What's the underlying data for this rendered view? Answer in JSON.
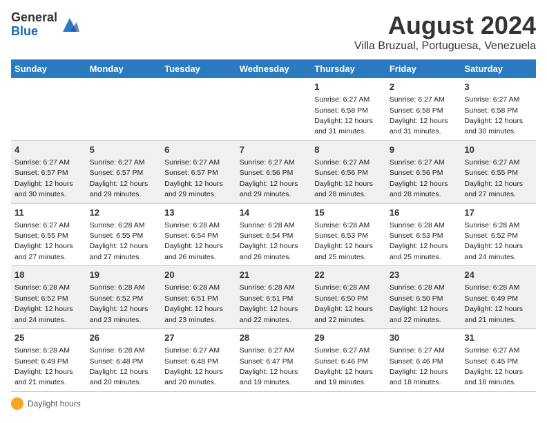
{
  "logo": {
    "general": "General",
    "blue": "Blue"
  },
  "title": "August 2024",
  "subtitle": "Villa Bruzual, Portuguesa, Venezuela",
  "days_of_week": [
    "Sunday",
    "Monday",
    "Tuesday",
    "Wednesday",
    "Thursday",
    "Friday",
    "Saturday"
  ],
  "weeks": [
    [
      {
        "num": "",
        "info": ""
      },
      {
        "num": "",
        "info": ""
      },
      {
        "num": "",
        "info": ""
      },
      {
        "num": "",
        "info": ""
      },
      {
        "num": "1",
        "info": "Sunrise: 6:27 AM\nSunset: 6:58 PM\nDaylight: 12 hours and 31 minutes."
      },
      {
        "num": "2",
        "info": "Sunrise: 6:27 AM\nSunset: 6:58 PM\nDaylight: 12 hours and 31 minutes."
      },
      {
        "num": "3",
        "info": "Sunrise: 6:27 AM\nSunset: 6:58 PM\nDaylight: 12 hours and 30 minutes."
      }
    ],
    [
      {
        "num": "4",
        "info": "Sunrise: 6:27 AM\nSunset: 6:57 PM\nDaylight: 12 hours and 30 minutes."
      },
      {
        "num": "5",
        "info": "Sunrise: 6:27 AM\nSunset: 6:57 PM\nDaylight: 12 hours and 29 minutes."
      },
      {
        "num": "6",
        "info": "Sunrise: 6:27 AM\nSunset: 6:57 PM\nDaylight: 12 hours and 29 minutes."
      },
      {
        "num": "7",
        "info": "Sunrise: 6:27 AM\nSunset: 6:56 PM\nDaylight: 12 hours and 29 minutes."
      },
      {
        "num": "8",
        "info": "Sunrise: 6:27 AM\nSunset: 6:56 PM\nDaylight: 12 hours and 28 minutes."
      },
      {
        "num": "9",
        "info": "Sunrise: 6:27 AM\nSunset: 6:56 PM\nDaylight: 12 hours and 28 minutes."
      },
      {
        "num": "10",
        "info": "Sunrise: 6:27 AM\nSunset: 6:55 PM\nDaylight: 12 hours and 27 minutes."
      }
    ],
    [
      {
        "num": "11",
        "info": "Sunrise: 6:27 AM\nSunset: 6:55 PM\nDaylight: 12 hours and 27 minutes."
      },
      {
        "num": "12",
        "info": "Sunrise: 6:28 AM\nSunset: 6:55 PM\nDaylight: 12 hours and 27 minutes."
      },
      {
        "num": "13",
        "info": "Sunrise: 6:28 AM\nSunset: 6:54 PM\nDaylight: 12 hours and 26 minutes."
      },
      {
        "num": "14",
        "info": "Sunrise: 6:28 AM\nSunset: 6:54 PM\nDaylight: 12 hours and 26 minutes."
      },
      {
        "num": "15",
        "info": "Sunrise: 6:28 AM\nSunset: 6:53 PM\nDaylight: 12 hours and 25 minutes."
      },
      {
        "num": "16",
        "info": "Sunrise: 6:28 AM\nSunset: 6:53 PM\nDaylight: 12 hours and 25 minutes."
      },
      {
        "num": "17",
        "info": "Sunrise: 6:28 AM\nSunset: 6:52 PM\nDaylight: 12 hours and 24 minutes."
      }
    ],
    [
      {
        "num": "18",
        "info": "Sunrise: 6:28 AM\nSunset: 6:52 PM\nDaylight: 12 hours and 24 minutes."
      },
      {
        "num": "19",
        "info": "Sunrise: 6:28 AM\nSunset: 6:52 PM\nDaylight: 12 hours and 23 minutes."
      },
      {
        "num": "20",
        "info": "Sunrise: 6:28 AM\nSunset: 6:51 PM\nDaylight: 12 hours and 23 minutes."
      },
      {
        "num": "21",
        "info": "Sunrise: 6:28 AM\nSunset: 6:51 PM\nDaylight: 12 hours and 22 minutes."
      },
      {
        "num": "22",
        "info": "Sunrise: 6:28 AM\nSunset: 6:50 PM\nDaylight: 12 hours and 22 minutes."
      },
      {
        "num": "23",
        "info": "Sunrise: 6:28 AM\nSunset: 6:50 PM\nDaylight: 12 hours and 22 minutes."
      },
      {
        "num": "24",
        "info": "Sunrise: 6:28 AM\nSunset: 6:49 PM\nDaylight: 12 hours and 21 minutes."
      }
    ],
    [
      {
        "num": "25",
        "info": "Sunrise: 6:28 AM\nSunset: 6:49 PM\nDaylight: 12 hours and 21 minutes."
      },
      {
        "num": "26",
        "info": "Sunrise: 6:28 AM\nSunset: 6:48 PM\nDaylight: 12 hours and 20 minutes."
      },
      {
        "num": "27",
        "info": "Sunrise: 6:27 AM\nSunset: 6:48 PM\nDaylight: 12 hours and 20 minutes."
      },
      {
        "num": "28",
        "info": "Sunrise: 6:27 AM\nSunset: 6:47 PM\nDaylight: 12 hours and 19 minutes."
      },
      {
        "num": "29",
        "info": "Sunrise: 6:27 AM\nSunset: 6:46 PM\nDaylight: 12 hours and 19 minutes."
      },
      {
        "num": "30",
        "info": "Sunrise: 6:27 AM\nSunset: 6:46 PM\nDaylight: 12 hours and 18 minutes."
      },
      {
        "num": "31",
        "info": "Sunrise: 6:27 AM\nSunset: 6:45 PM\nDaylight: 12 hours and 18 minutes."
      }
    ]
  ],
  "footer": {
    "icon": "sun",
    "label": "Daylight hours"
  }
}
